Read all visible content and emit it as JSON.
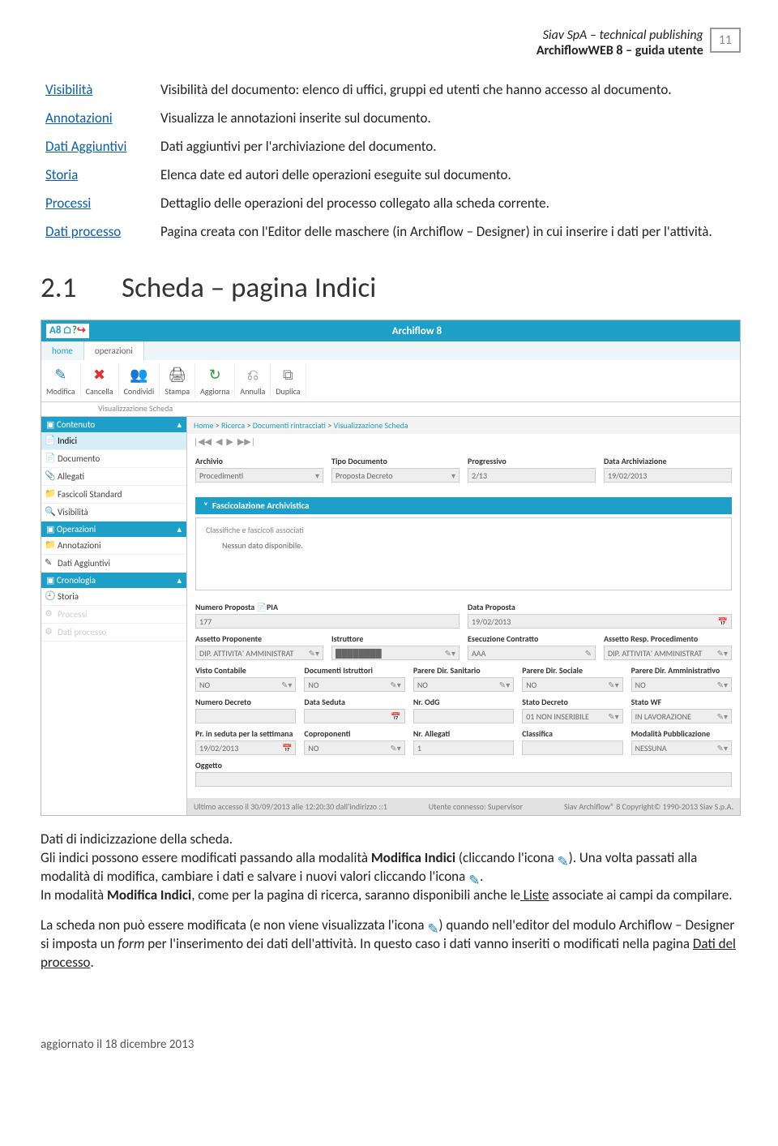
{
  "header": {
    "company": "Siav SpA – technical publishing",
    "title": "ArchiflowWEB 8 – guida utente",
    "page": "11"
  },
  "defs": [
    {
      "term": "Visibilità",
      "desc": "Visibilità del documento: elenco di uffici, gruppi ed utenti che hanno accesso al documento."
    },
    {
      "term": "Annotazioni",
      "desc": "Visualizza le annotazioni inserite sul documento."
    },
    {
      "term": "Dati Aggiuntivi",
      "desc": "Dati aggiuntivi per l'archiviazione del documento."
    },
    {
      "term": "Storia",
      "desc": "Elenca date ed autori delle operazioni eseguite sul documento."
    },
    {
      "term": "Processi",
      "desc": "Dettaglio delle operazioni del processo collegato alla scheda corrente."
    },
    {
      "term": "Dati processo",
      "desc": "Pagina creata con l'Editor delle maschere (in Archiflow – Designer) in cui inserire i dati per l'attività."
    }
  ],
  "section": {
    "num": "2.1",
    "title": "Scheda – pagina Indici"
  },
  "app": {
    "title": "Archiflow 8",
    "logo": "A8",
    "tabs": [
      "home",
      "operazioni"
    ],
    "activeTab": 1,
    "ribbon": [
      {
        "label": "Modifica",
        "icon": "✎",
        "color": "#1e7fc0"
      },
      {
        "label": "Cancella",
        "icon": "✖",
        "color": "#d33"
      },
      {
        "label": "Condividi",
        "icon": "👥",
        "color": "#1e9fc8"
      },
      {
        "label": "Stampa",
        "icon": "🖨",
        "color": "#555"
      },
      {
        "label": "Aggiorna",
        "icon": "↻",
        "color": "#2a9d3e"
      },
      {
        "label": "Annulla",
        "icon": "⎌",
        "color": "#888"
      },
      {
        "label": "Duplica",
        "icon": "⧉",
        "color": "#888"
      }
    ],
    "ribbonGroup": "Visualizzazione Scheda",
    "sidebar": [
      {
        "type": "hdr",
        "label": "Contenuto"
      },
      {
        "type": "item",
        "label": "Indici",
        "icon": "📄",
        "sel": true
      },
      {
        "type": "item",
        "label": "Documento",
        "icon": "📄"
      },
      {
        "type": "item",
        "label": "Allegati",
        "icon": "📎"
      },
      {
        "type": "item",
        "label": "Fascicoli Standard",
        "icon": "📁"
      },
      {
        "type": "item",
        "label": "Visibilità",
        "icon": "🔍"
      },
      {
        "type": "hdr",
        "label": "Operazioni"
      },
      {
        "type": "item",
        "label": "Annotazioni",
        "icon": "📁"
      },
      {
        "type": "item",
        "label": "Dati Aggiuntivi",
        "icon": "✎"
      },
      {
        "type": "hdr",
        "label": "Cronologia"
      },
      {
        "type": "item",
        "label": "Storia",
        "icon": "🕘"
      },
      {
        "type": "item",
        "label": "Processi",
        "icon": "⚙",
        "dim": true
      },
      {
        "type": "item",
        "label": "Dati processo",
        "icon": "⚙",
        "dim": true
      }
    ],
    "breadcrumb": [
      "Home",
      "Ricerca",
      "Documenti rintracciati",
      "Visualizzazione Scheda"
    ],
    "topFields": [
      {
        "label": "Archivio",
        "value": "Procedimenti",
        "ddl": true
      },
      {
        "label": "Tipo Documento",
        "value": "Proposta Decreto",
        "ddl": true
      },
      {
        "label": "Progressivo",
        "value": "2/13"
      },
      {
        "label": "Data Archiviazione",
        "value": "19/02/2013"
      }
    ],
    "archPanel": {
      "title": "Fascicolazione Archivistica",
      "sub": "Classifiche e fascicoli associati",
      "empty": "Nessun dato disponibile."
    },
    "rows": [
      [
        {
          "label": "Numero Proposta 📄PIA",
          "value": "177",
          "w": 2
        },
        {
          "label": "Data Proposta",
          "value": "19/02/2013",
          "w": 2,
          "cal": true
        }
      ],
      [
        {
          "label": "Assetto Proponente",
          "value": "DIP. ATTIVITA' AMMINISTRAT",
          "ddl": true,
          "ed": true
        },
        {
          "label": "Istruttore",
          "value": "████████",
          "ddl": true,
          "ed": true
        },
        {
          "label": "Esecuzione Contratto",
          "value": "AAA",
          "ed": true
        },
        {
          "label": "Assetto Resp. Procedimento",
          "value": "DIP. ATTIVITA' AMMINISTRAT",
          "ddl": true,
          "ed": true
        }
      ],
      [
        {
          "label": "Visto Contabile",
          "value": "NO",
          "ddl": true,
          "ed": true
        },
        {
          "label": "Documenti Istruttori",
          "value": "NO",
          "ddl": true,
          "ed": true
        },
        {
          "label": "Parere Dir. Sanitario",
          "value": "NO",
          "ddl": true,
          "ed": true
        },
        {
          "label": "Parere Dir. Sociale",
          "value": "NO",
          "ddl": true,
          "ed": true
        },
        {
          "label": "Parere Dir. Amministrativo",
          "value": "NO",
          "ddl": true,
          "ed": true
        }
      ],
      [
        {
          "label": "Numero Decreto",
          "value": ""
        },
        {
          "label": "Data Seduta",
          "value": "",
          "cal": true
        },
        {
          "label": "Nr. OdG",
          "value": ""
        },
        {
          "label": "Stato Decreto",
          "value": "01 NON INSERIBILE",
          "ddl": true,
          "ed": true
        },
        {
          "label": "Stato WF",
          "value": "IN LAVORAZIONE",
          "ddl": true,
          "ed": true
        }
      ],
      [
        {
          "label": "Pr. in seduta per la settimana",
          "value": "19/02/2013",
          "cal": true
        },
        {
          "label": "Coproponenti",
          "value": "NO",
          "ddl": true,
          "ed": true
        },
        {
          "label": "Nr. Allegati",
          "value": "1"
        },
        {
          "label": "Classifica",
          "value": ""
        },
        {
          "label": "Modalità Pubblicazione",
          "value": "NESSUNA",
          "ddl": true,
          "ed": true
        }
      ],
      [
        {
          "label": "Oggetto",
          "value": "",
          "w": 5
        }
      ]
    ],
    "status": {
      "left": "Ultimo accesso il 30/09/2013 alle 12:20:30 dall'indirizzo ::1",
      "mid": "Utente connesso: Supervisor",
      "right": "Siav Archiflow® 8 Copyright© 1990-2013 Siav S.p.A."
    }
  },
  "para": {
    "p1a": "Dati di indicizzazione della scheda.",
    "p1b": "Gli indici possono essere modificati passando alla modalità ",
    "p1c": "Modifica Indici",
    "p1d": " (cliccando l'icona ",
    "p1e": "). Una volta passati alla modalità di modifica, cambiare i dati e salvare i nuovi valori cliccando l'icona ",
    "p1f": ".",
    "p2a": "In modalità ",
    "p2b": "Modifica Indici",
    "p2c": ", come per la pagina di ricerca, saranno disponibili anche le",
    "p2d": " Liste",
    "p2e": " associate ai campi da compilare.",
    "p3a": "La scheda non può essere modificata (e non viene visualizzata l'icona ",
    "p3b": ") quando nell'editor del modulo Archiflow – Designer si imposta un ",
    "p3c": "form",
    "p3d": " per l'inserimento dei dati dell'attività. In questo caso i dati vanno inseriti o modificati nella pagina ",
    "p3e": "Dati del processo",
    "p3f": "."
  },
  "footer": "aggiornato il 18 dicembre 2013"
}
